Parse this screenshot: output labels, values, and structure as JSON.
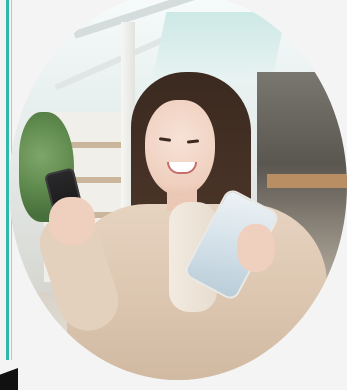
{
  "photo": {
    "alt_subject": "woman-holding-phone-and-device",
    "colors": {
      "accent_rule": "#2fb9a9",
      "background": "#f4f4f4",
      "coat": "#dcc6b0",
      "hair": "#3b2a20"
    }
  },
  "icons": {
    "corner_mark": "corner-mark"
  }
}
